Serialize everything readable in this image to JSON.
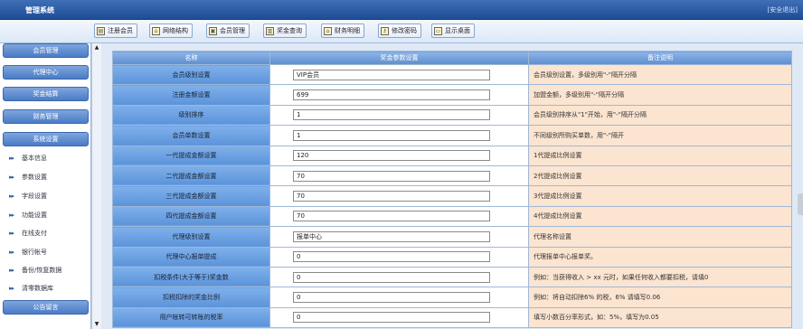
{
  "app": {
    "title": "管理系统",
    "logout": "[安全退出]"
  },
  "toolbar": [
    {
      "label": "注册会员",
      "icon": "register-icon"
    },
    {
      "label": "网络结构",
      "icon": "network-icon"
    },
    {
      "label": "会员管理",
      "icon": "member-icon"
    },
    {
      "label": "奖金查询",
      "icon": "bonus-query-icon"
    },
    {
      "label": "财务明细",
      "icon": "finance-icon"
    },
    {
      "label": "修改密码",
      "icon": "key-icon"
    },
    {
      "label": "显示桌面",
      "icon": "desktop-icon"
    }
  ],
  "sidebar": {
    "sections": [
      "会员管理",
      "代理中心",
      "奖金结算",
      "财务管理",
      "系统设置"
    ],
    "items": [
      "基本信息",
      "参数设置",
      "字段设置",
      "功能设置",
      "在线支付",
      "银行帐号",
      "备份/恢复数据",
      "清零数据库"
    ],
    "bottom": "公告留言"
  },
  "table": {
    "headers": [
      "名称",
      "奖金参数设置",
      "备注说明"
    ],
    "rows": [
      {
        "label": "会员级别设置",
        "value": "VIP会员",
        "note": "会员级别设置，多级别用\"-\"隔开分隔"
      },
      {
        "label": "注册金额设置",
        "value": "699",
        "note": "加盟金额，多级别用\"-\"隔开分隔"
      },
      {
        "label": "级别排序",
        "value": "1",
        "note": "会员级别排序从\"1\"开始，用\"-\"隔开分隔"
      },
      {
        "label": "会员单数设置",
        "value": "1",
        "note": "不同级别所购买单数，用\"-\"隔开"
      },
      {
        "label": "一代提成金额设置",
        "value": "120",
        "note": "1代提成比例设置"
      },
      {
        "label": "二代提成金额设置",
        "value": "70",
        "note": "2代提成比例设置"
      },
      {
        "label": "三代提成金额设置",
        "value": "70",
        "note": "3代提成比例设置"
      },
      {
        "label": "四代提成金额设置",
        "value": "70",
        "note": "4代提成比例设置"
      },
      {
        "label": "代理级别设置",
        "value": "报单中心",
        "note": "代理名称设置"
      },
      {
        "label": "代理中心报单提成",
        "value": "0",
        "note": "代理报单中心报单奖。"
      },
      {
        "label": "扣税条件(大于等于)奖金数",
        "value": "0",
        "note": "例如：当获得收入 > xx 元时，如果任何收入都要扣税，请填0"
      },
      {
        "label": "扣税扣除的奖金比例",
        "value": "0",
        "note": "例如：将自动扣除6% 的税，6% 请填写0.06"
      },
      {
        "label": "用户帐转可转账的税率",
        "value": "0",
        "note": "填写小数百分率形式，如：5%，填写为0.05"
      }
    ]
  }
}
